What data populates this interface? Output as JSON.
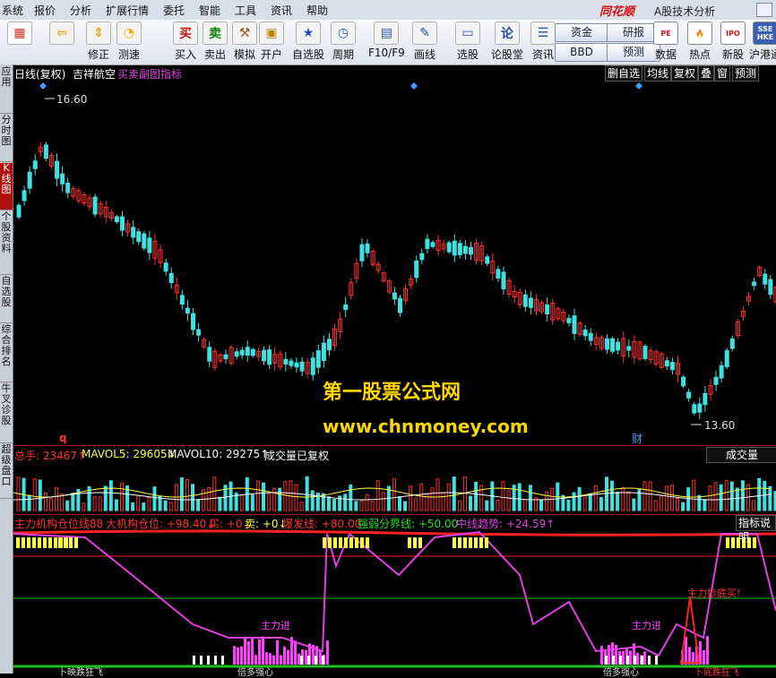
{
  "menu": {
    "items": [
      "系统",
      "报价",
      "分析",
      "扩展行情",
      "委托",
      "智能",
      "工具",
      "资讯",
      "帮助"
    ],
    "brand": "同花顺",
    "app_title": "A股技术分析"
  },
  "toolbar": {
    "buttons": [
      {
        "label": "",
        "icon": "grid-icon",
        "color": "#c8302a"
      },
      {
        "label": "",
        "icon": "back-arrow-icon",
        "color": "#f2a000"
      },
      {
        "label": "修正",
        "icon": "updown-arrows-icon",
        "color": "#e8a000"
      },
      {
        "label": "测速",
        "icon": "speed-icon",
        "color": "#f2b000"
      },
      {
        "label": "买入",
        "icon": "buy-icon",
        "color": "#d01010"
      },
      {
        "label": "卖出",
        "icon": "sell-icon",
        "color": "#108010"
      },
      {
        "label": "模拟",
        "icon": "hammer-icon",
        "color": "#a05a20"
      },
      {
        "label": "开户",
        "icon": "lock-icon",
        "color": "#c08000"
      },
      {
        "label": "自选股",
        "icon": "star-box-icon",
        "color": "#2050b0"
      },
      {
        "label": "周期",
        "icon": "clock-icon",
        "color": "#2050b0"
      },
      {
        "label": "F10/F9",
        "icon": "f10-icon",
        "color": "#2050b0"
      },
      {
        "label": "画线",
        "icon": "pen-icon",
        "color": "#2050b0"
      },
      {
        "label": "选股",
        "icon": "screen-icon",
        "color": "#2050b0"
      },
      {
        "label": "论股堂",
        "icon": "chat-icon",
        "color": "#2050b0"
      },
      {
        "label": "资讯",
        "icon": "doc-icon",
        "color": "#2050b0"
      }
    ],
    "pills": [
      "资金",
      "研报",
      "BBD",
      "预测"
    ],
    "right_buttons": [
      {
        "label": "数据",
        "icon": "pe-icon",
        "glyph": "PE"
      },
      {
        "label": "热点",
        "icon": "fire-icon",
        "glyph": "🔥"
      },
      {
        "label": "新股",
        "icon": "new-stock-icon",
        "glyph": "IPO"
      },
      {
        "label": "沪港通",
        "icon": "hk-icon",
        "glyph": "SSE HKE"
      }
    ]
  },
  "leftnav": [
    {
      "label": "应用",
      "active": false
    },
    {
      "label": "分时图",
      "active": false
    },
    {
      "label": "K线图",
      "active": true
    },
    {
      "label": "个股资料",
      "active": false
    },
    {
      "label": "自选股",
      "active": false
    },
    {
      "label": "综合排名",
      "active": false
    },
    {
      "label": "牛叉诊股",
      "active": false
    },
    {
      "label": "超级盘口",
      "active": false
    }
  ],
  "main": {
    "period_label": "日线(复权)",
    "stock_name": "吉祥航空",
    "indicator_name": "买卖副图指标",
    "right_tabs": [
      "删自选",
      "均线",
      "复权",
      "叠",
      "窗",
      "预测"
    ],
    "high_label": "16.60",
    "low_label": "13.60",
    "marker_q": "q",
    "marker_cai": "财",
    "watermark_title": "第一股票公式网",
    "watermark_url": "www.chnmoney.com"
  },
  "volume": {
    "label_total": "总手: 23467↑",
    "label_mavol5": "MAVOL5: 29605↓",
    "label_mavol10": "MAVOL10: 29275↑",
    "note": "成交量已复权",
    "tab": "成交量"
  },
  "indicator": {
    "label_main": "主力机构仓位线88",
    "label_inst": "大机构仓位: +98.40↓",
    "label_buy": "买: +0↓",
    "label_sell": "卖: +0↓",
    "label_burst": "爆发线: +80.00",
    "label_split": "强弱分界线: +50.00",
    "label_trend": "中线趋势: +24.59↑",
    "tab": "指标说明",
    "ann_enter": "主力进",
    "ann_enter2": "主力进",
    "ann_bottom": "主力抄底买!",
    "bottom_labels": [
      "卜映跌狂飞",
      "倍多强心",
      "倍多强心",
      "卜底跌狂飞"
    ]
  },
  "colors": {
    "up": "#ff3030",
    "down": "#40e0e0",
    "ma": "#ffffff",
    "trend": "#e040e0",
    "burst": "#ff2020",
    "split": "#20c020",
    "bar_yellow": "#ffff40",
    "bar_magenta": "#ff40ff"
  }
}
